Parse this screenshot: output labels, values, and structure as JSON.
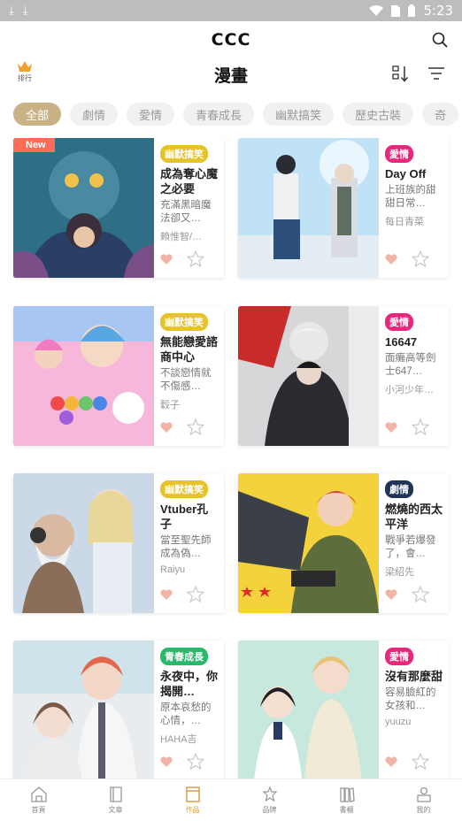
{
  "status_bar": {
    "time": "5:23"
  },
  "app": {
    "brand": "CCC",
    "page_title": "漫畫",
    "rank_label": "排行"
  },
  "categories": [
    {
      "label": "全部",
      "active": true
    },
    {
      "label": "劇情",
      "active": false
    },
    {
      "label": "愛情",
      "active": false
    },
    {
      "label": "青春成長",
      "active": false
    },
    {
      "label": "幽默搞笑",
      "active": false
    },
    {
      "label": "歷史古裝",
      "active": false
    },
    {
      "label": "奇",
      "active": false
    }
  ],
  "colors": {
    "accent": "#c9b386",
    "nav_active": "#d8a04a",
    "tag_humor": "#e6c22b",
    "tag_love": "#e8267a",
    "tag_drama": "#1f3557",
    "tag_youth": "#2ab86b",
    "new_tag": "#ff6b57"
  },
  "comics": [
    {
      "genre": "幽默搞笑",
      "genre_color": "#e6c22b",
      "title": "成為奪心魔之必要",
      "desc": "充滿黑暗魔法卻又…",
      "author": "賴惟智/…",
      "new": "New"
    },
    {
      "genre": "愛情",
      "genre_color": "#e8267a",
      "title": "Day Off",
      "desc": "上班族的甜甜日常…",
      "author": "每日青菜",
      "new": ""
    },
    {
      "genre": "幽默搞笑",
      "genre_color": "#e6c22b",
      "title": "無能戀愛諮商中心",
      "desc": "不談戀情就不傷感…",
      "author": "穀子",
      "new": ""
    },
    {
      "genre": "愛情",
      "genre_color": "#e8267a",
      "title": "16647",
      "desc": "面癱高等劍士647…",
      "author": "小河少年…",
      "new": ""
    },
    {
      "genre": "幽默搞笑",
      "genre_color": "#e6c22b",
      "title": "Vtuber孔子",
      "desc": "當至聖先師成為偽…",
      "author": "Raiyu",
      "new": ""
    },
    {
      "genre": "劇情",
      "genre_color": "#1f3557",
      "title": "燃燒的西太平洋",
      "desc": "戰爭若爆發了，會…",
      "author": "梁紹先",
      "new": ""
    },
    {
      "genre": "青春成長",
      "genre_color": "#2ab86b",
      "title": "永夜中，你揭開…",
      "desc": "原本哀愁的心情，…",
      "author": "HAHA吉",
      "new": ""
    },
    {
      "genre": "愛情",
      "genre_color": "#e8267a",
      "title": "沒有那麼甜",
      "desc": "容易臉紅的女孩和…",
      "author": "yuuzu",
      "new": ""
    }
  ],
  "bottom_nav": [
    {
      "label": "首頁",
      "icon": "home-icon",
      "active": false
    },
    {
      "label": "文章",
      "icon": "article-icon",
      "active": false
    },
    {
      "label": "作品",
      "icon": "works-icon",
      "active": true
    },
    {
      "label": "品牌",
      "icon": "brand-icon",
      "active": false
    },
    {
      "label": "書櫃",
      "icon": "bookshelf-icon",
      "active": false
    },
    {
      "label": "我的",
      "icon": "profile-icon",
      "active": false
    }
  ]
}
